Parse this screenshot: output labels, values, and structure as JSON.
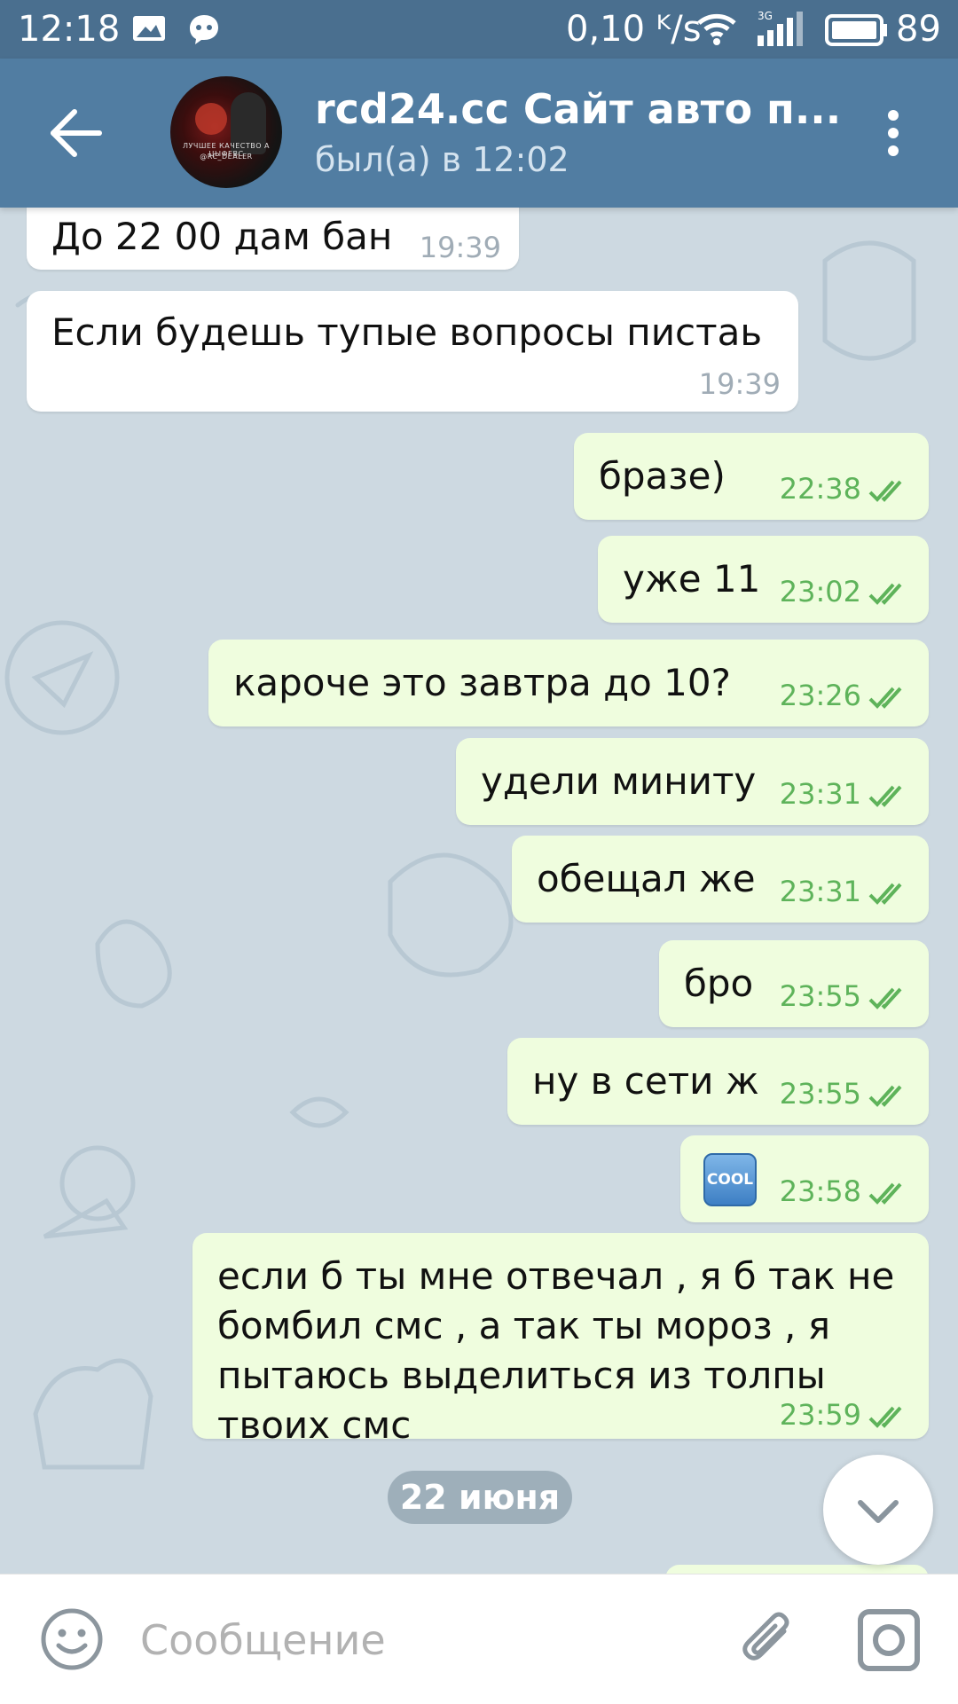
{
  "status_bar": {
    "time": "12:18",
    "net_speed": "0,10 ᴷ/s",
    "battery": "89"
  },
  "header": {
    "title": "rcd24.cc Сайт авто п...",
    "status": "был(а) в 12:02",
    "avatar_caption_1": "ЛУЧШЕЕ КАЧЕСТВО А ЦЫФЕВС",
    "avatar_caption_2": "@RC_DEALER"
  },
  "messages": [
    {
      "dir": "in",
      "text": "До 22 00 дам бан",
      "time": "19:39"
    },
    {
      "dir": "in",
      "text": "Если будешь тупые вопросы пистаь",
      "time": "19:39"
    },
    {
      "dir": "out",
      "text": "бразе)",
      "time": "22:38"
    },
    {
      "dir": "out",
      "text": "уже 11",
      "time": "23:02"
    },
    {
      "dir": "out",
      "text": "кароче это завтра до 10?",
      "time": "23:26"
    },
    {
      "dir": "out",
      "text": "удели миниту",
      "time": "23:31"
    },
    {
      "dir": "out",
      "text": "обещал же",
      "time": "23:31"
    },
    {
      "dir": "out",
      "text": "бро",
      "time": "23:55"
    },
    {
      "dir": "out",
      "text": "ну в сети ж",
      "time": "23:55"
    },
    {
      "dir": "out",
      "text": "COOL",
      "emoji": true,
      "time": "23:58"
    },
    {
      "dir": "out",
      "lines": [
        "если б ты мне отвечал , я б так не",
        "бомбил смс , а так ты мороз , я",
        "пытаюсь выделиться из толпы",
        "твоих смс"
      ],
      "time": "23:59"
    }
  ],
  "date_divider": "22 июня",
  "composer": {
    "placeholder": "Сообщение"
  },
  "colors": {
    "header": "#517da2",
    "status_bar": "#4a6f8f",
    "incoming_bubble": "#ffffff",
    "outgoing_bubble": "#effdde",
    "outgoing_meta": "#5eb35a"
  },
  "icons": [
    "back-arrow-icon",
    "more-vert-icon",
    "double-check-icon",
    "chevron-down-icon",
    "emoji-icon",
    "attach-icon",
    "camera-icon",
    "wifi-icon",
    "signal-icon",
    "battery-icon"
  ]
}
